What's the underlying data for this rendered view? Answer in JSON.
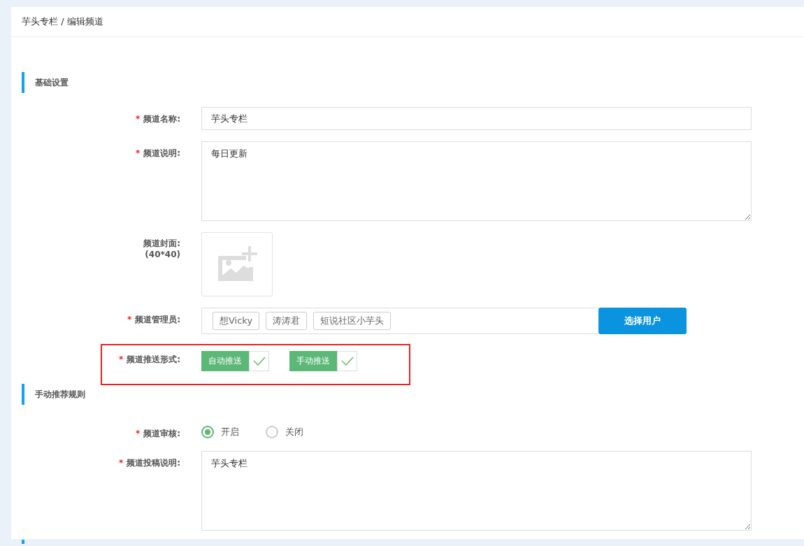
{
  "breadcrumb": "芋头专栏 / 编辑频道",
  "sections": [
    {
      "title": "基础设置"
    },
    {
      "title": "手动推荐规则"
    }
  ],
  "channel_name": {
    "mark": "*",
    "label": "频道名称:",
    "value": "芋头专栏"
  },
  "channel_desc": {
    "mark": "*",
    "label": "频道说明:",
    "value": "每日更新"
  },
  "cover": {
    "label": "频道封面:",
    "size": "(40*40)"
  },
  "admins": {
    "mark": "*",
    "label": "频道管理员:",
    "tags": [
      "想Vicky",
      "涛涛君",
      "短说社区小芋头"
    ],
    "button": "选择用户"
  },
  "push": {
    "mark": "*",
    "label": "频道推送形式:",
    "modes": [
      {
        "label": "自动推送",
        "checked": true
      },
      {
        "label": "手动推送",
        "checked": true
      }
    ]
  },
  "review": {
    "mark": "*",
    "label": "频道审核:",
    "options": [
      {
        "label": "开启",
        "selected": true
      },
      {
        "label": "关闭",
        "selected": false
      }
    ]
  },
  "submission": {
    "mark": "*",
    "label": "频道投稿说明:",
    "value": "芋头专栏"
  }
}
